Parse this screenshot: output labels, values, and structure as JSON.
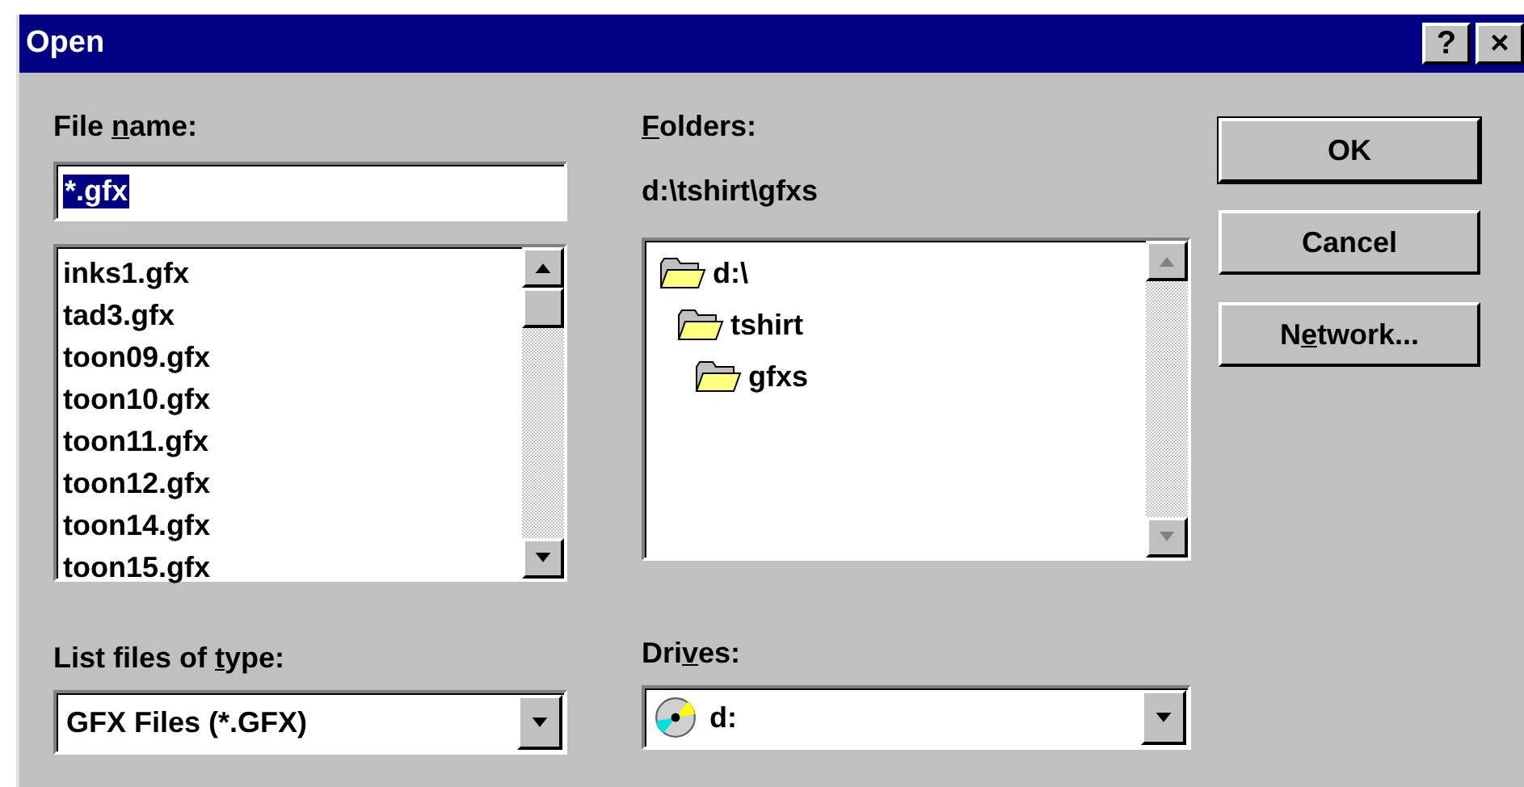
{
  "window": {
    "title": "Open",
    "title_buttons": [
      "?",
      "×"
    ]
  },
  "file_name": {
    "label": [
      {
        "text": "File "
      },
      {
        "text": "n",
        "underlined": true
      },
      {
        "text": "ame:"
      }
    ],
    "value": "*.gfx",
    "text_selected": true
  },
  "files": {
    "scrollable": true,
    "items": [
      {
        "label": "inks1.gfx"
      },
      {
        "label": "tad3.gfx"
      },
      {
        "label": "toon09.gfx"
      },
      {
        "label": "toon10.gfx"
      },
      {
        "label": "toon11.gfx"
      },
      {
        "label": "toon12.gfx"
      },
      {
        "label": "toon14.gfx"
      },
      {
        "label": "toon15.gfx"
      }
    ]
  },
  "file_type": {
    "label": [
      {
        "text": "List files of "
      },
      {
        "text": "t",
        "underlined": true
      },
      {
        "text": "ype:"
      }
    ],
    "value": "GFX Files (*.GFX)"
  },
  "folders": {
    "label": [
      {
        "text": "F",
        "underlined": true
      },
      {
        "text": "olders:"
      }
    ],
    "path": "d:\\tshirt\\gfxs",
    "scrollable": false,
    "tree": [
      {
        "label": "d:\\",
        "children": [
          {
            "label": "tshirt",
            "children": [
              {
                "label": "gfxs"
              }
            ]
          }
        ]
      }
    ]
  },
  "drives": {
    "label": [
      {
        "text": "Dri"
      },
      {
        "text": "v",
        "underlined": true
      },
      {
        "text": "es:"
      }
    ],
    "value": "d:"
  },
  "buttons": [
    {
      "label": [
        {
          "text": "OK"
        }
      ],
      "default": true
    },
    {
      "label": [
        {
          "text": "Cancel"
        }
      ],
      "default": false
    },
    {
      "label": [
        {
          "text": "N"
        },
        {
          "text": "e",
          "underlined": true
        },
        {
          "text": "twork..."
        }
      ],
      "default": false
    }
  ]
}
